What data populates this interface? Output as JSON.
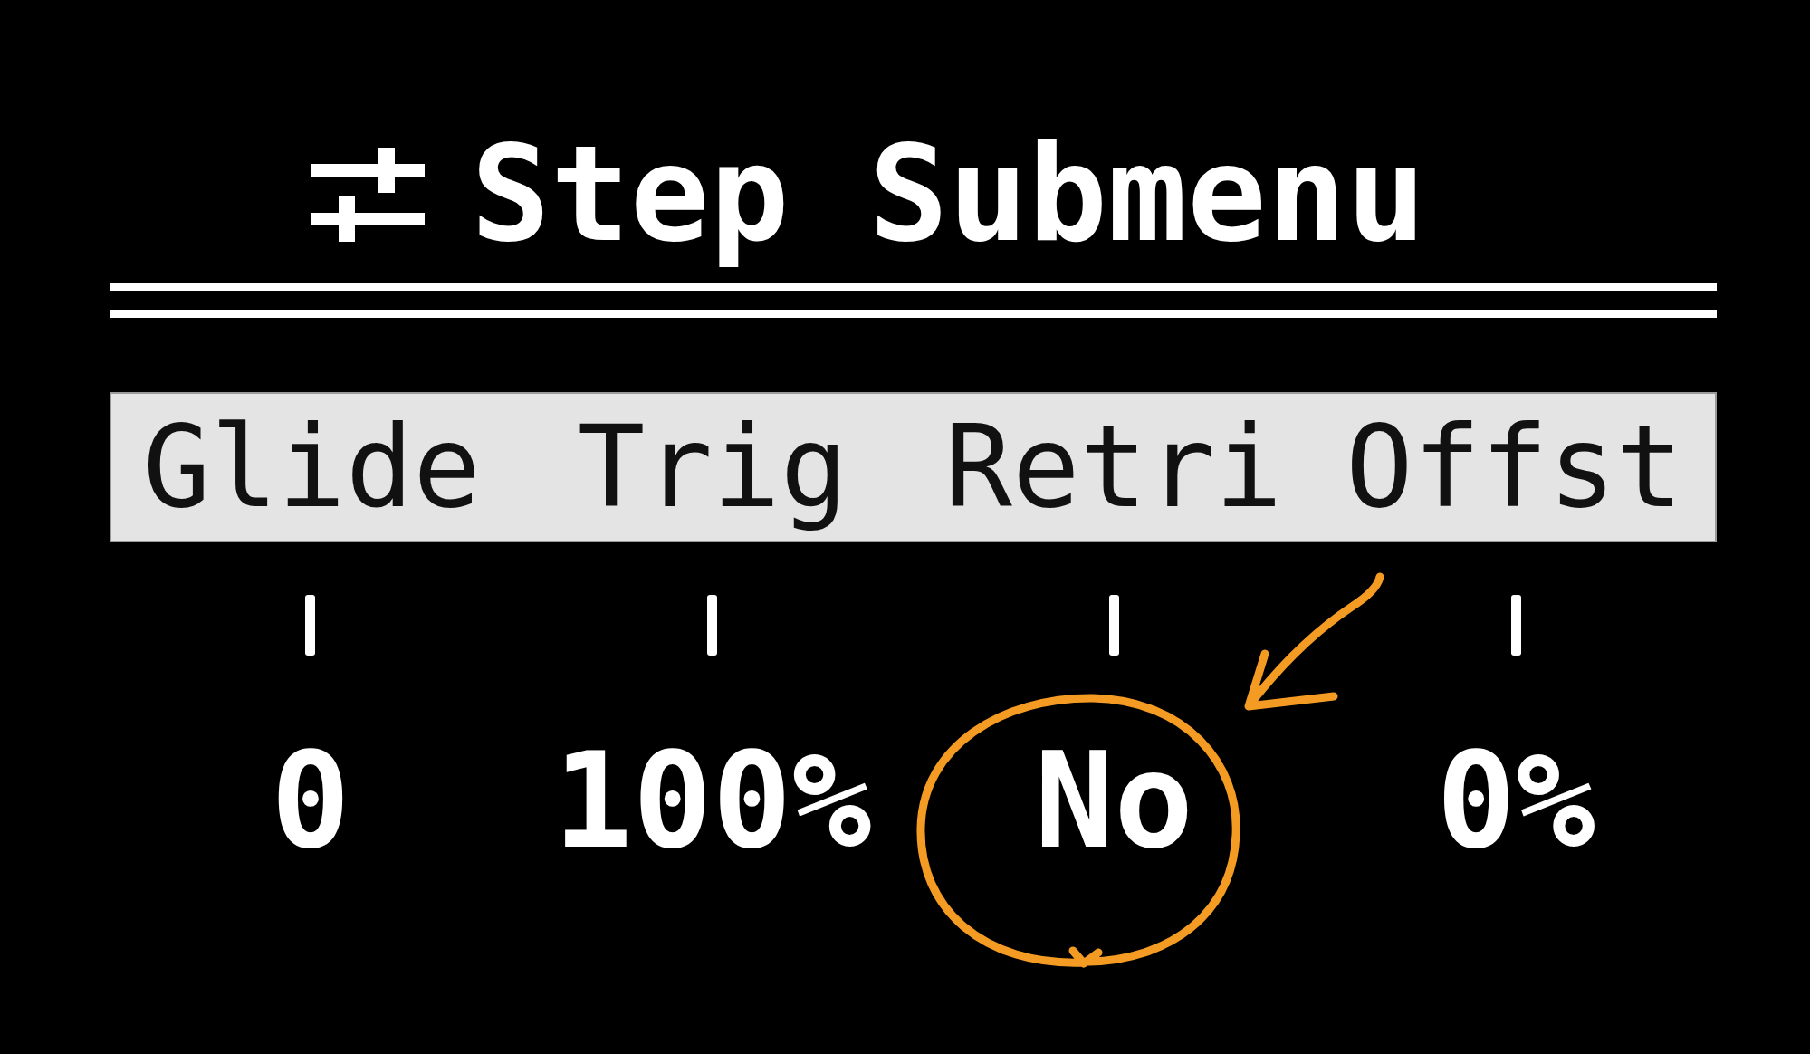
{
  "header": {
    "title": "Step Submenu"
  },
  "columns": [
    {
      "label": "Glide",
      "value": "0",
      "circled": false
    },
    {
      "label": "Trig",
      "value": "100%",
      "circled": false
    },
    {
      "label": "Retri",
      "value": "No",
      "circled": true
    },
    {
      "label": "Offst",
      "value": "0%",
      "circled": false
    }
  ]
}
